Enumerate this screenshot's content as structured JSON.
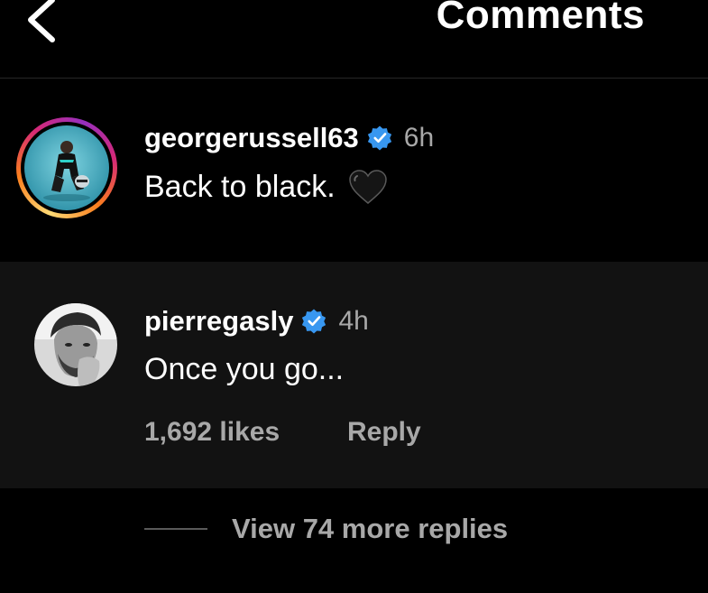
{
  "header": {
    "title": "Comments",
    "back_icon": "chevron-left-icon"
  },
  "caption": {
    "username": "georgerussell63",
    "verified": true,
    "time": "6h",
    "text": "Back to black.",
    "emoji": "black-heart-icon"
  },
  "comment": {
    "username": "pierregasly",
    "verified": true,
    "time": "4h",
    "text": "Once you go...",
    "likes": "1,692 likes",
    "reply_label": "Reply"
  },
  "replies": {
    "view_more_label": "View 74 more replies"
  },
  "colors": {
    "background": "#000000",
    "comment_bg": "#121212",
    "secondary_text": "#a8a8a8",
    "verified_blue": "#3897f0"
  }
}
